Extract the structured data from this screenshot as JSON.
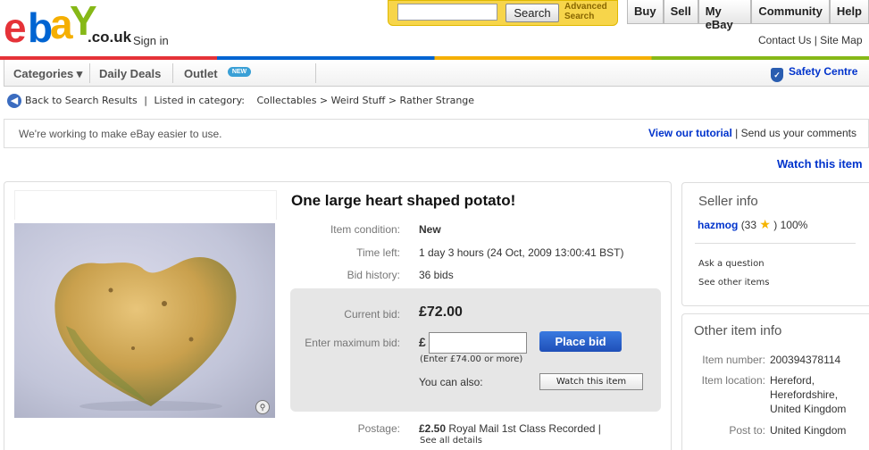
{
  "header": {
    "logo_letters": [
      "e",
      "b",
      "a",
      "Y"
    ],
    "logo_colors": [
      "#e53238",
      "#0064d2",
      "#f5af02",
      "#86b817"
    ],
    "domain": ".co.uk",
    "sign_in": "Sign in",
    "search_value": "",
    "search_button": "Search",
    "advanced_search": [
      "Advanced",
      "Search"
    ],
    "top_nav": [
      "Buy",
      "Sell",
      "My eBay",
      "Community",
      "Help"
    ],
    "contact": "Contact Us | Site Map"
  },
  "nav": {
    "categories": "Categories ▾",
    "daily_deals": "Daily Deals",
    "outlet": "Outlet",
    "new_badge": "NEW",
    "safety": "Safety Centre"
  },
  "breadcrumb": {
    "back": "Back to Search Results",
    "sep": "|",
    "listed": "Listed in category:",
    "path": "Collectables > Weird Stuff > Rather Strange"
  },
  "infostrip": {
    "message": "We're working to make eBay easier to use.",
    "tutorial": "View our tutorial",
    "separator": " | ",
    "comments": "Send us your comments"
  },
  "watch_top": "Watch this item",
  "item": {
    "title": "One large heart shaped potato!",
    "condition_label": "Item condition:",
    "condition": "New",
    "time_label": "Time left:",
    "time": "1 day 3 hours (24 Oct, 2009  13:00:41 BST)",
    "bids_label": "Bid history:",
    "bids": "36 bids",
    "current_bid_label": "Current bid:",
    "current_bid": "£72.00",
    "max_bid_label": "Enter maximum bid:",
    "currency": "£",
    "max_bid_value": "",
    "bid_hint": "(Enter £74.00 or more)",
    "place_bid": "Place bid",
    "also_label": "You can also:",
    "watch_button": "Watch this item",
    "postage_label": "Postage:",
    "postage_price": "£2.50",
    "postage_method": "Royal Mail 1st Class Recorded  |",
    "see_details": "See all details"
  },
  "seller": {
    "title": "Seller info",
    "name": "hazmog",
    "score_open": "(33",
    "score_close": ")",
    "positive": "100%",
    "ask": "Ask a question",
    "other_items": "See other items"
  },
  "other_info": {
    "title": "Other item info",
    "number_label": "Item number:",
    "number": "200394378114",
    "location_label": "Item location:",
    "location": [
      "Hereford,",
      "Herefordshire,",
      "United Kingdom"
    ],
    "post_label": "Post to:",
    "post": "United Kingdom"
  }
}
